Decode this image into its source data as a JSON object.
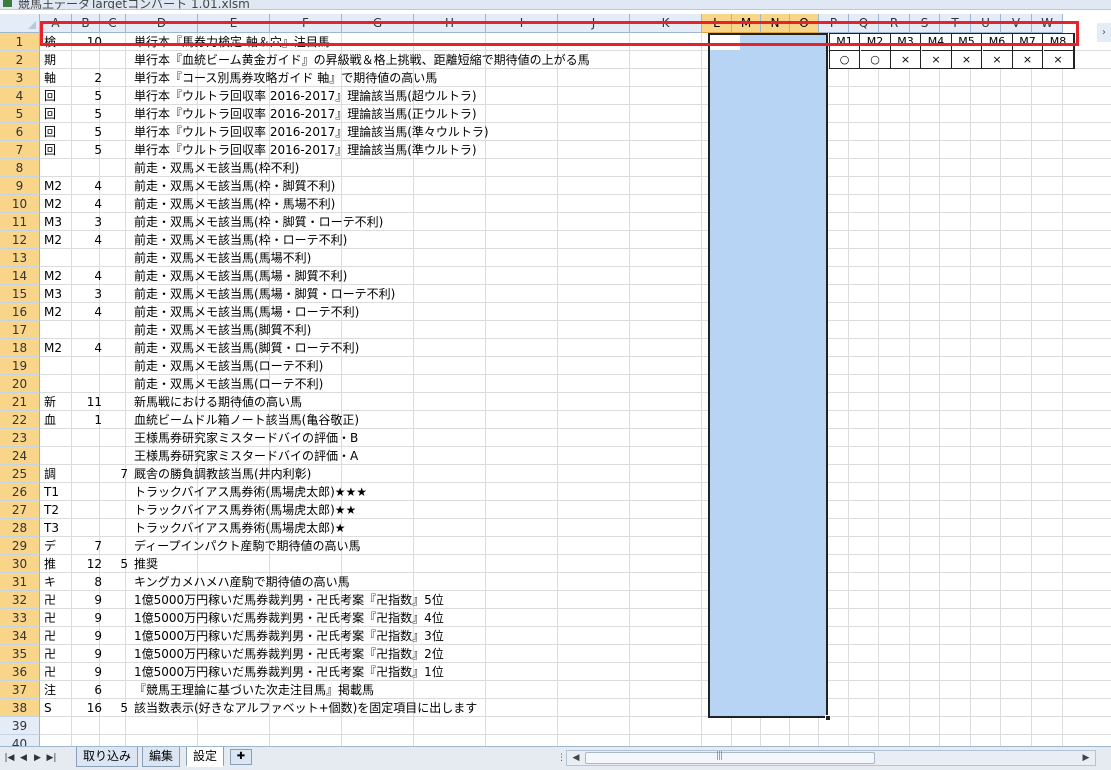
{
  "window": {
    "title": "競馬王データTargetコンバート 1.01.xlsm"
  },
  "columns": [
    "A",
    "B",
    "C",
    "D",
    "E",
    "F",
    "G",
    "H",
    "I",
    "J",
    "K",
    "L",
    "M",
    "N",
    "O",
    "P",
    "Q",
    "R",
    "S",
    "T",
    "U",
    "V",
    "W"
  ],
  "selected_columns": [
    "L",
    "M",
    "N",
    "O"
  ],
  "selected_range": "L1:O38",
  "active_cell": "L1",
  "rows": [
    {
      "n": "1",
      "a": "検",
      "b": "10",
      "c": "",
      "d": "単行本『馬券力検定 軸＆穴』注目馬"
    },
    {
      "n": "2",
      "a": "期",
      "b": "",
      "c": "",
      "d": "単行本『血統ビーム黄金ガイド』の昇級戦＆格上挑戦、距離短縮で期待値の上がる馬"
    },
    {
      "n": "3",
      "a": "軸",
      "b": "2",
      "c": "",
      "d": "単行本『コース別馬券攻略ガイド 軸』で期待値の高い馬"
    },
    {
      "n": "4",
      "a": "回",
      "b": "5",
      "c": "",
      "d": "単行本『ウルトラ回収率 2016-2017』理論該当馬(超ウルトラ)"
    },
    {
      "n": "5",
      "a": "回",
      "b": "5",
      "c": "",
      "d": "単行本『ウルトラ回収率 2016-2017』理論該当馬(正ウルトラ)"
    },
    {
      "n": "6",
      "a": "回",
      "b": "5",
      "c": "",
      "d": "単行本『ウルトラ回収率 2016-2017』理論該当馬(準々ウルトラ)"
    },
    {
      "n": "7",
      "a": "回",
      "b": "5",
      "c": "",
      "d": "単行本『ウルトラ回収率 2016-2017』理論該当馬(準ウルトラ)"
    },
    {
      "n": "8",
      "a": "",
      "b": "",
      "c": "",
      "d": "前走・双馬メモ該当馬(枠不利)"
    },
    {
      "n": "9",
      "a": "M2",
      "b": "4",
      "c": "",
      "d": "前走・双馬メモ該当馬(枠・脚質不利)"
    },
    {
      "n": "10",
      "a": "M2",
      "b": "4",
      "c": "",
      "d": "前走・双馬メモ該当馬(枠・馬場不利)"
    },
    {
      "n": "11",
      "a": "M3",
      "b": "3",
      "c": "",
      "d": "前走・双馬メモ該当馬(枠・脚質・ローテ不利)"
    },
    {
      "n": "12",
      "a": "M2",
      "b": "4",
      "c": "",
      "d": "前走・双馬メモ該当馬(枠・ローテ不利)"
    },
    {
      "n": "13",
      "a": "",
      "b": "",
      "c": "",
      "d": "前走・双馬メモ該当馬(馬場不利)"
    },
    {
      "n": "14",
      "a": "M2",
      "b": "4",
      "c": "",
      "d": "前走・双馬メモ該当馬(馬場・脚質不利)"
    },
    {
      "n": "15",
      "a": "M3",
      "b": "3",
      "c": "",
      "d": "前走・双馬メモ該当馬(馬場・脚質・ローテ不利)"
    },
    {
      "n": "16",
      "a": "M2",
      "b": "4",
      "c": "",
      "d": "前走・双馬メモ該当馬(馬場・ローテ不利)"
    },
    {
      "n": "17",
      "a": "",
      "b": "",
      "c": "",
      "d": "前走・双馬メモ該当馬(脚質不利)"
    },
    {
      "n": "18",
      "a": "M2",
      "b": "4",
      "c": "",
      "d": "前走・双馬メモ該当馬(脚質・ローテ不利)"
    },
    {
      "n": "19",
      "a": "",
      "b": "",
      "c": "",
      "d": "前走・双馬メモ該当馬(ローテ不利)"
    },
    {
      "n": "20",
      "a": "",
      "b": "",
      "c": "",
      "d": "前走・双馬メモ該当馬(ローテ不利)"
    },
    {
      "n": "21",
      "a": "新",
      "b": "11",
      "c": "",
      "d": "新馬戦における期待値の高い馬"
    },
    {
      "n": "22",
      "a": "血",
      "b": "1",
      "c": "",
      "d": "血統ビームドル箱ノート該当馬(亀谷敬正)"
    },
    {
      "n": "23",
      "a": "",
      "b": "",
      "c": "",
      "d": "王様馬券研究家ミスタードバイの評価・B"
    },
    {
      "n": "24",
      "a": "",
      "b": "",
      "c": "",
      "d": "王様馬券研究家ミスタードバイの評価・A"
    },
    {
      "n": "25",
      "a": "調",
      "b": "",
      "c": "7",
      "d": "厩舎の勝負調教該当馬(井内利彰)"
    },
    {
      "n": "26",
      "a": "T1",
      "b": "",
      "c": "",
      "d": "トラックバイアス馬券術(馬場虎太郎)★★★"
    },
    {
      "n": "27",
      "a": "T2",
      "b": "",
      "c": "",
      "d": "トラックバイアス馬券術(馬場虎太郎)★★"
    },
    {
      "n": "28",
      "a": "T3",
      "b": "",
      "c": "",
      "d": "トラックバイアス馬券術(馬場虎太郎)★"
    },
    {
      "n": "29",
      "a": "デ",
      "b": "7",
      "c": "",
      "d": "ディープインパクト産駒で期待値の高い馬"
    },
    {
      "n": "30",
      "a": "推",
      "b": "12",
      "c": "5",
      "d": "推奨"
    },
    {
      "n": "31",
      "a": "キ",
      "b": "8",
      "c": "",
      "d": "キングカメハメハ産駒で期待値の高い馬"
    },
    {
      "n": "32",
      "a": "卍",
      "b": "9",
      "c": "",
      "d": "1億5000万円稼いだ馬券裁判男・卍氏考案『卍指数』5位"
    },
    {
      "n": "33",
      "a": "卍",
      "b": "9",
      "c": "",
      "d": "1億5000万円稼いだ馬券裁判男・卍氏考案『卍指数』4位"
    },
    {
      "n": "34",
      "a": "卍",
      "b": "9",
      "c": "",
      "d": "1億5000万円稼いだ馬券裁判男・卍氏考案『卍指数』3位"
    },
    {
      "n": "35",
      "a": "卍",
      "b": "9",
      "c": "",
      "d": "1億5000万円稼いだ馬券裁判男・卍氏考案『卍指数』2位"
    },
    {
      "n": "36",
      "a": "卍",
      "b": "9",
      "c": "",
      "d": "1億5000万円稼いだ馬券裁判男・卍氏考案『卍指数』1位"
    },
    {
      "n": "37",
      "a": "注",
      "b": "6",
      "c": "",
      "d": "『競馬王理論に基づいた次走注目馬』掲載馬"
    },
    {
      "n": "38",
      "a": "S",
      "b": "16",
      "c": "5",
      "d": "該当数表示(好きなアルファベット+個数)を固定項目に出します"
    },
    {
      "n": "39",
      "a": "",
      "b": "",
      "c": "",
      "d": ""
    },
    {
      "n": "40",
      "a": "",
      "b": "",
      "c": "",
      "d": ""
    }
  ],
  "m_table": {
    "headers": [
      "M1",
      "M2",
      "M3",
      "M4",
      "M5",
      "M6",
      "M7",
      "M8"
    ],
    "values": [
      "○",
      "○",
      "×",
      "×",
      "×",
      "×",
      "×",
      "×"
    ]
  },
  "sheet_tabs": [
    "取り込み",
    "編集",
    "設定"
  ],
  "active_tab": "設定",
  "colors": {
    "selection_fill": "#b8d4f4",
    "header_highlight": "#f9d58a",
    "annotation_box": "#e8222a"
  }
}
